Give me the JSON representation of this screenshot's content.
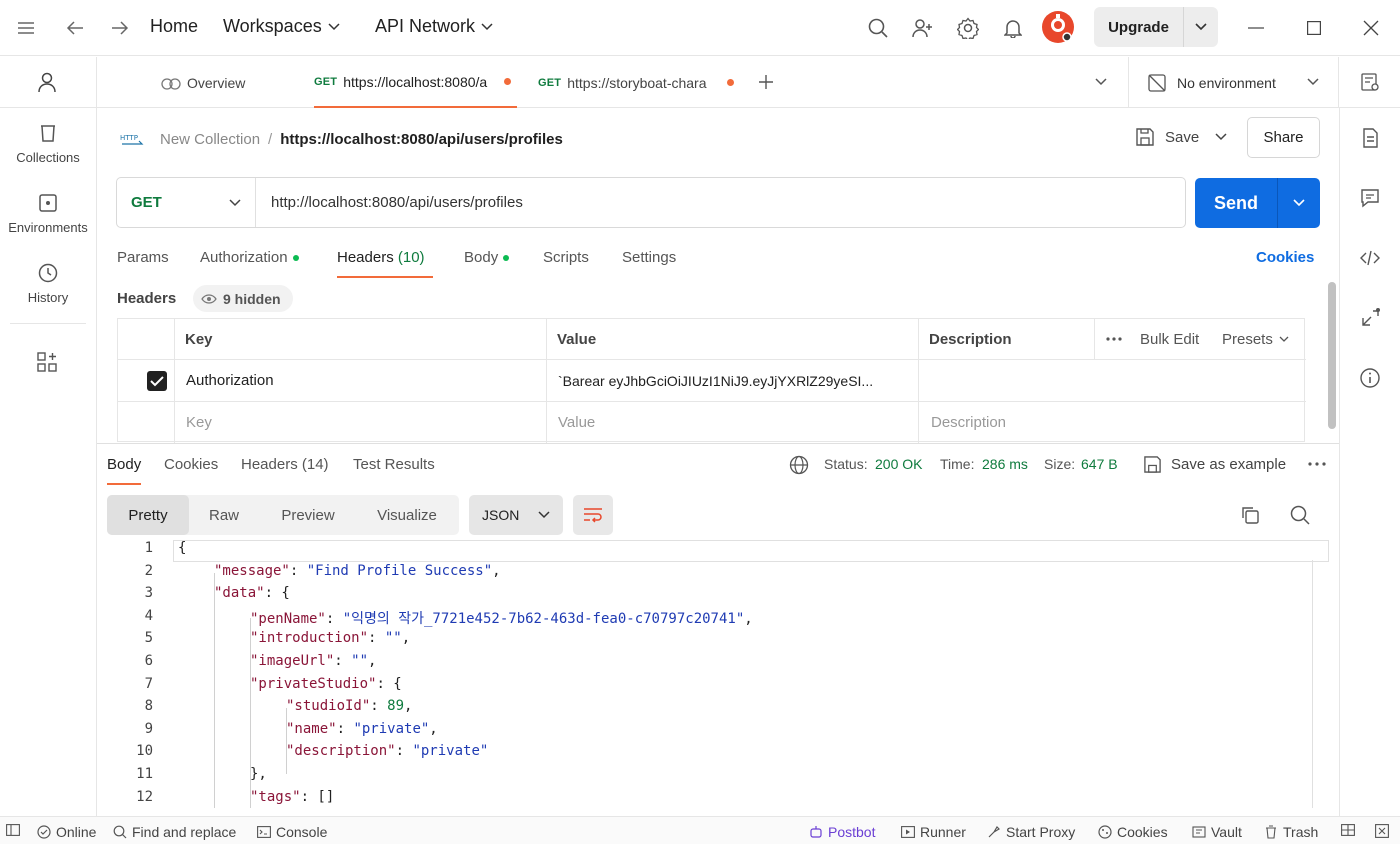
{
  "titlebar": {
    "home": "Home",
    "workspaces": "Workspaces",
    "api_network": "API Network",
    "upgrade": "Upgrade"
  },
  "sidebar": {
    "items": [
      {
        "label": "Collections"
      },
      {
        "label": "Environments"
      },
      {
        "label": "History"
      }
    ]
  },
  "tabs": {
    "overview": "Overview",
    "tab1": {
      "method": "GET",
      "title": "https://localhost:8080/a"
    },
    "tab2": {
      "method": "GET",
      "title": "https://storyboat-chara"
    },
    "environment": "No environment"
  },
  "breadcrumb": {
    "collection": "New Collection",
    "separator": "/",
    "request": "https://localhost:8080/api/users/profiles",
    "save": "Save",
    "share": "Share"
  },
  "request": {
    "method": "GET",
    "url": "http://localhost:8080/api/users/profiles",
    "send": "Send"
  },
  "request_tabs": {
    "params": "Params",
    "authorization": "Authorization",
    "headers": "Headers",
    "headers_count": "(10)",
    "body": "Body",
    "scripts": "Scripts",
    "settings": "Settings",
    "cookies": "Cookies"
  },
  "headers_section": {
    "title": "Headers",
    "hidden": "9 hidden",
    "columns": {
      "key": "Key",
      "value": "Value",
      "description": "Description"
    },
    "bulk_edit": "Bulk Edit",
    "presets": "Presets",
    "rows": [
      {
        "key": "Authorization",
        "value": "`Barear eyJhbGciOiJIUzI1NiJ9.eyJjYXRlZ29yeSI...",
        "description": ""
      }
    ],
    "placeholder": {
      "key": "Key",
      "value": "Value",
      "description": "Description"
    }
  },
  "response": {
    "tabs": {
      "body": "Body",
      "cookies": "Cookies",
      "headers": "Headers (14)",
      "test_results": "Test Results"
    },
    "status_label": "Status:",
    "status": "200 OK",
    "time_label": "Time:",
    "time": "286 ms",
    "size_label": "Size:",
    "size": "647 B",
    "save_example": "Save as example",
    "views": [
      "Pretty",
      "Raw",
      "Preview",
      "Visualize"
    ],
    "format": "JSON"
  },
  "code_lines": [
    "{",
    "\"message\": \"Find Profile Success\",",
    "\"data\": {",
    "\"penName\": \"익명의 작가_7721e452-7b62-463d-fea0-c70797c20741\",",
    "\"introduction\": \"\",",
    "\"imageUrl\": \"\",",
    "\"privateStudio\": {",
    "\"studioId\": 89,",
    "\"name\": \"private\",",
    "\"description\": \"private\"",
    "},",
    "\"tags\": []"
  ],
  "statusbar": {
    "online": "Online",
    "find_replace": "Find and replace",
    "console": "Console",
    "postbot": "Postbot",
    "runner": "Runner",
    "start_proxy": "Start Proxy",
    "cookies": "Cookies",
    "vault": "Vault",
    "trash": "Trash"
  },
  "colors": {
    "accent": "#0f6ce1",
    "get_method": "#0f7b3e",
    "unsaved_dot": "#f26b3a",
    "tab_underline": "#f26b3a"
  }
}
